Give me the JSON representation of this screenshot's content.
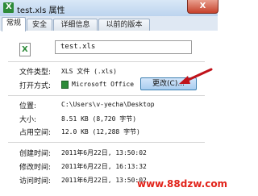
{
  "window": {
    "title": "test.xls 属性",
    "close_label": "X"
  },
  "tabs": [
    {
      "label": "常规",
      "active": true
    },
    {
      "label": "安全",
      "active": false
    },
    {
      "label": "详细信息",
      "active": false
    },
    {
      "label": "以前的版本",
      "active": false
    }
  ],
  "general": {
    "file_name": "test.xls",
    "file_type_label": "文件类型:",
    "file_type_value": "XLS 文件 (.xls)",
    "open_with_label": "打开方式:",
    "open_with_value": "Microsoft Office 2(",
    "change_button": "更改(C)...",
    "location_label": "位置:",
    "location_value": "C:\\Users\\v-yecha\\Desktop",
    "size_label": "大小:",
    "size_value": "8.51 KB (8,720 字节)",
    "size_on_disk_label": "占用空间:",
    "size_on_disk_value": "12.0 KB (12,288 字节)",
    "created_label": "创建时间:",
    "created_value": "2011年6月22日, 13:50:02",
    "modified_label": "修改时间:",
    "modified_value": "2011年6月22日, 16:13:32",
    "accessed_label": "访问时间:",
    "accessed_value": "2011年6月22日, 13:50:02"
  },
  "watermark": "www.88dzw.com",
  "icons": {
    "title_icon": "excel-file-icon",
    "file_icon": "excel-file-icon",
    "arrow": "red-arrow-annotation"
  },
  "colors": {
    "arrow": "#c0121a",
    "watermark": "#e2231a",
    "change_button_border": "#3c7fb1"
  }
}
